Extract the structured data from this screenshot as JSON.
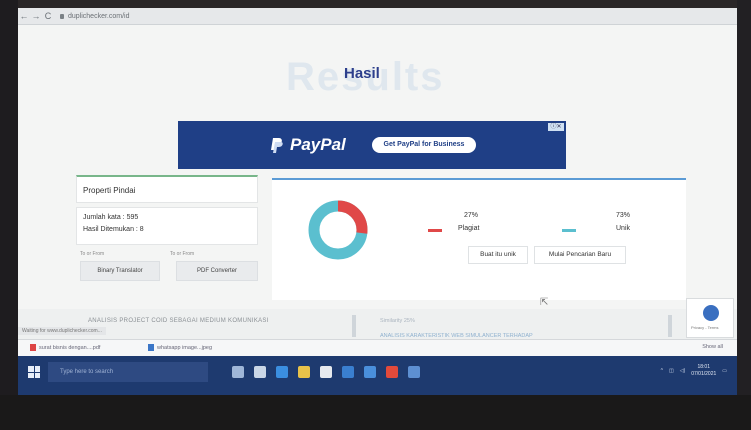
{
  "browser": {
    "back": "←",
    "forward": "→",
    "reload": "C",
    "url": "duplichecker.com/id"
  },
  "page": {
    "bg_heading": "Results",
    "title": "Hasil"
  },
  "ad": {
    "brand": "PayPal",
    "cta": "Get PayPal for Business",
    "badge": "ⓘ✕"
  },
  "properties": {
    "header": "Properti Pindai",
    "word_count": "Jumlah kata : 595",
    "results_found": "Hasil Ditemukan : 8",
    "to_from_1": "To or From",
    "to_from_2": "To or From",
    "tool_1": "Binary Translator",
    "tool_2": "PDF Converter"
  },
  "results": {
    "plagiat_pct": "27%",
    "plagiat_label": "Plagiat",
    "unik_pct": "73%",
    "unik_label": "Unik",
    "plagiat_value": 27,
    "unik_value": 73,
    "color_plagiat": "#e04848",
    "color_unik": "#5bbfcf",
    "btn_make_unique": "Buat itu unik",
    "btn_new_search": "Mulai Pencarian Baru"
  },
  "lower": {
    "left_title": "ANALISIS PROJECT COID SEBAGAI MEDIUM KOMUNIKASI",
    "similarity": "Similarity 25%",
    "right_title": "ANALISIS KARAKTERISTIK WEB SIMULANCER TERHADAP"
  },
  "status_bar": {
    "text": "Waiting for www.duplichecker.com..."
  },
  "downloads": {
    "item_1": "surat bisnis dengan....pdf",
    "item_2": "whatsapp image...jpeg",
    "show_all": "Show all"
  },
  "taskbar": {
    "search_placeholder": "Type here to search",
    "time": "18:01",
    "date": "07/01/2021"
  },
  "recaptcha": {
    "text": "Privacy - Terms"
  }
}
